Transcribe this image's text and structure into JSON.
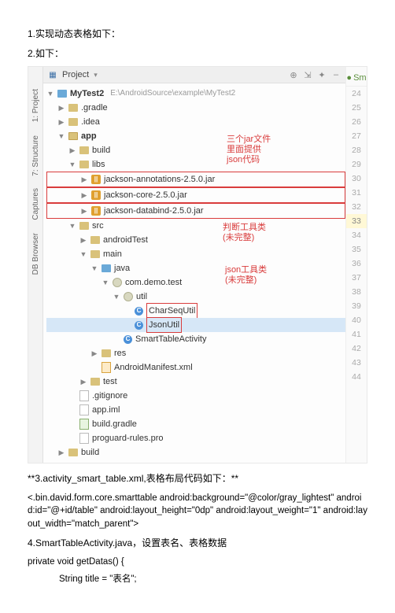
{
  "text": {
    "h1": "1.实现动态表格如下：",
    "h2": "2.如下：",
    "project_label": "Project",
    "sm_tab": "Sm",
    "root_name": "MyTest2",
    "root_path": "E:\\AndroidSource\\example\\MyTest2",
    "left_tabs": {
      "t1": "1: Project",
      "t2": "7: Structure",
      "t3": "Captures",
      "t4": "DB Browser"
    },
    "nodes": {
      "gradle": ".gradle",
      "idea": ".idea",
      "app": "app",
      "build": "build",
      "libs": "libs",
      "jar1": "jackson-annotations-2.5.0.jar",
      "jar2": "jackson-core-2.5.0.jar",
      "jar3": "jackson-databind-2.5.0.jar",
      "src": "src",
      "androidTest": "androidTest",
      "main": "main",
      "java": "java",
      "pkg": "com.demo.test",
      "util": "util",
      "cls1": "CharSeqUtil",
      "cls2": "JsonUtil",
      "cls3": "SmartTableActivity",
      "res": "res",
      "manifest": "AndroidManifest.xml",
      "test": "test",
      "gitignore": ".gitignore",
      "appiml": "app.iml",
      "buildgradle": "build.gradle",
      "proguard": "proguard-rules.pro",
      "build2": "build"
    },
    "annot": {
      "a1": "三个jar文件\n里面提供\njson代码",
      "a2": "判断工具类\n(未完整)",
      "a3": "json工具类\n(未完整)"
    },
    "lines": [
      "24",
      "25",
      "26",
      "27",
      "28",
      "29",
      "30",
      "31",
      "32",
      "33",
      "34",
      "35",
      "36",
      "37",
      "38",
      "39",
      "40",
      "41",
      "42",
      "43",
      "44"
    ],
    "cur_line_index": 9,
    "sec3": "**3.activity_smart_table.xml,表格布局代码如下：**",
    "code1": "<.bin.david.form.core.smarttable android:background=\"@color/gray_lightest\" android:id=\"@+id/table\" android:layout_height=\"0dp\" android:layout_weight=\"1\" android:layout_width=\"match_parent\">",
    "sec4": "4.SmartTableActivity.java，设置表名、表格数据",
    "code2": "private void getDatas() {",
    "code3": "String title = \"表名\";"
  }
}
